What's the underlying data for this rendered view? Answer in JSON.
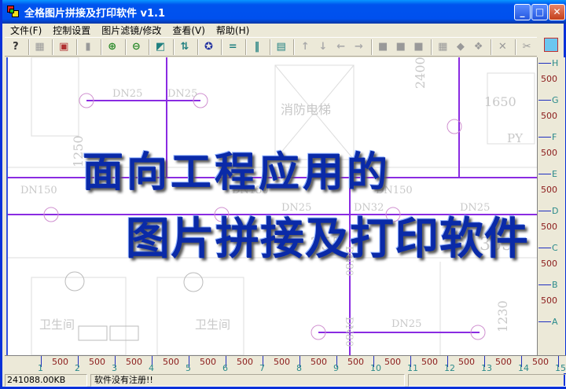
{
  "window": {
    "title": "全格图片拼接及打印软件  v1.1"
  },
  "menu": [
    "文件(F)",
    "控制设置",
    "图片滤镜/修改",
    "查看(V)",
    "帮助(H)"
  ],
  "toolbar": {
    "icons": [
      "help-icon",
      "grid-icon",
      "image-icon",
      "panel-icon",
      "zoom-in-icon",
      "zoom-out-icon",
      "refresh-icon",
      "swap-icon",
      "target-icon",
      "horizontal-lines-icon",
      "vertical-lines-icon",
      "save-icon",
      "arrow-up-icon",
      "arrow-down-icon",
      "arrow-left-icon",
      "arrow-right-icon",
      "square-1-icon",
      "square-2-icon",
      "square-3-icon",
      "layout-icon",
      "shape-icon",
      "layers-icon",
      "delete-icon",
      "cut-icon"
    ]
  },
  "overlay": {
    "line1": "面向工程应用的",
    "line2": "图片拼接及打印软件"
  },
  "plan_labels": {
    "dn25": "DN25",
    "dn150": "DN150",
    "dn32": "DN32",
    "dn80": "DN80",
    "elevator": "消防电梯",
    "bathroom": "卫生间",
    "py": "PY",
    "d1250": "1250",
    "d2400": "2400",
    "d1650": "1650",
    "d1230": "1230",
    "d3550": "355"
  },
  "ruler_bottom": {
    "ticks": [
      "1",
      "2",
      "3",
      "4",
      "5",
      "6",
      "7",
      "8",
      "9",
      "10",
      "11",
      "12",
      "13",
      "14",
      "15"
    ],
    "spacing": "500"
  },
  "ruler_right": {
    "ticks": [
      "H",
      "G",
      "F",
      "E",
      "D",
      "C",
      "B",
      "A"
    ],
    "spacing": "500"
  },
  "status": {
    "size": "241088.00KB",
    "message": "软件没有注册!!"
  },
  "colors": {
    "pipe": "#8a2be2",
    "ruler_number": "#8b1a1a",
    "ruler_letter": "#2a8a8a"
  }
}
